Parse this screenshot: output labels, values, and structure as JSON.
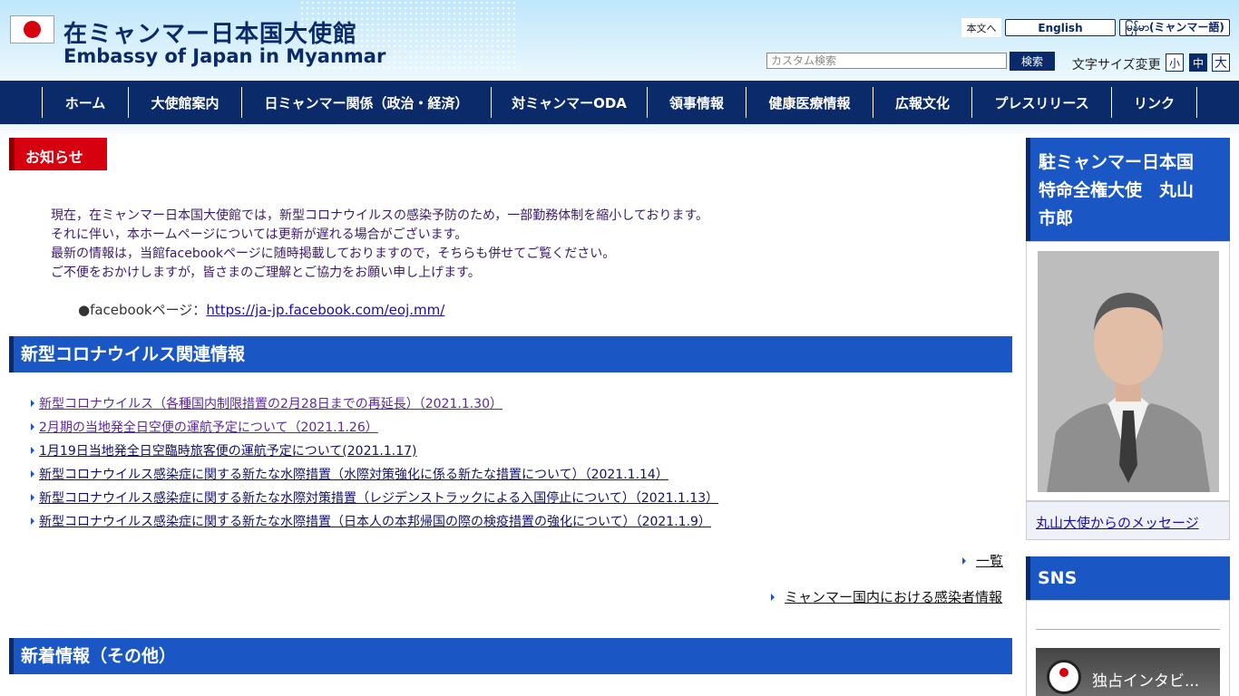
{
  "header": {
    "title_ja": "在ミャンマー日本国大使館",
    "title_en": "Embassy of Japan in Myanmar",
    "skip_link": "本文へ",
    "lang_english": "English",
    "lang_myanmar": "မြန်မာ(ミャンマー語)",
    "search_placeholder": "カスタム検索",
    "search_button": "検索",
    "font_size_label": "文字サイズ変更",
    "font_small": "小",
    "font_medium": "中",
    "font_large": "大"
  },
  "nav": [
    "ホーム",
    "大使館案内",
    "日ミャンマー関係（政治・経済）",
    "対ミャンマーODA",
    "領事情報",
    "健康医療情報",
    "広報文化",
    "プレスリリース",
    "リンク"
  ],
  "notice": {
    "heading": "お知らせ",
    "lines": [
      "現在，在ミャンマー日本国大使館では，新型コロナウイルスの感染予防のため，一部勤務体制を縮小しております。",
      "それに伴い，本ホームページについては更新が遅れる場合がございます。",
      "最新の情報は，当館facebookページに随時掲載しておりますので，そちらも併せてご覧ください。",
      "ご不便をおかけしますが，皆さまのご理解とご協力をお願い申し上げます。"
    ],
    "fb_label": "●facebookページ：",
    "fb_url": "https://ja-jp.facebook.com/eoj.mm/"
  },
  "covid": {
    "heading": "新型コロナウイルス関連情報",
    "items": [
      "新型コロナウイルス（各種国内制限措置の2月28日までの再延長）（2021.1.30）",
      "2月期の当地発全日空便の運航予定について（2021.1.26）",
      "1月19日当地発全日空臨時旅客便の運航予定について(2021.1.17)",
      "新型コロナウイルス感染症に関する新たな水際措置（水際対策強化に係る新たな措置について）（2021.1.14）",
      "新型コロナウイルス感染症に関する新たな水際対策措置（レジデンストラックによる入国停止について）（2021.1.13）",
      "新型コロナウイルス感染症に関する新たな水際措置（日本人の本邦帰国の際の検疫措置の強化について）（2021.1.9）"
    ],
    "list_link": "一覧",
    "cases_link": "ミャンマー国内における感染者情報"
  },
  "news_heading": "新着情報（その他）",
  "sidebar": {
    "ambassador_line1": "駐ミャンマー日本国",
    "ambassador_line2": "特命全権大使　丸山",
    "ambassador_line3": "市郎",
    "message_link": "丸山大使からのメッセージ",
    "sns_heading": "SNS",
    "video_title": "独占インタビ..."
  },
  "colors": {
    "navy": "#0a2a6a",
    "blue": "#1a56c4",
    "red": "#d7000f"
  }
}
